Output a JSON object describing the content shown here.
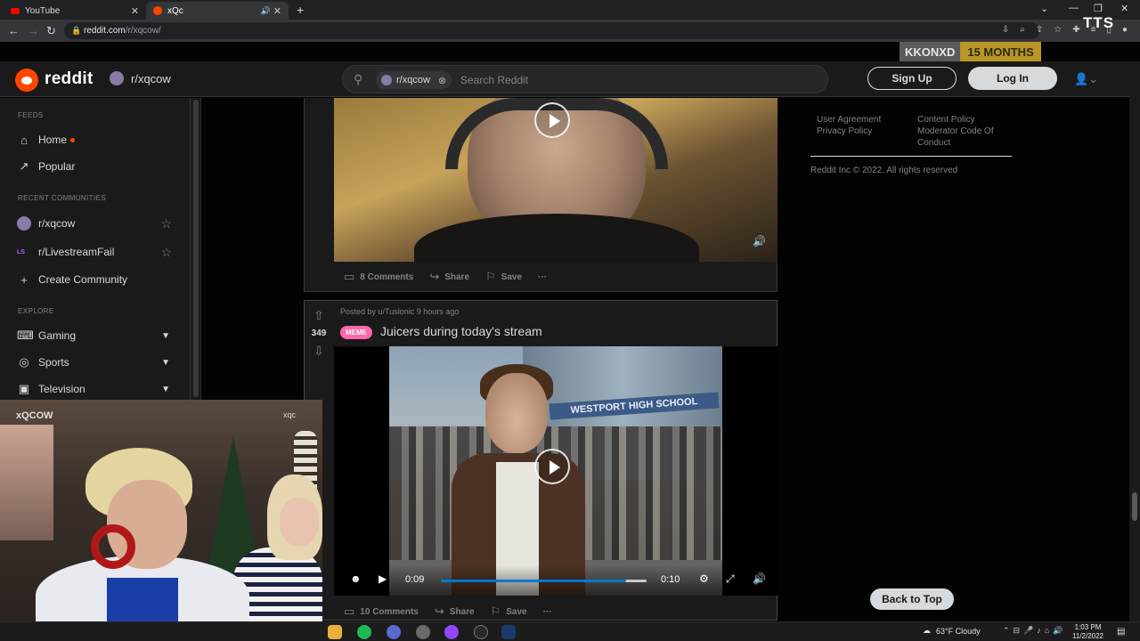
{
  "browser": {
    "tabs": [
      {
        "label": "YouTube",
        "favicon": "youtube-icon"
      },
      {
        "label": "xQc",
        "favicon": "reddit-icon",
        "active": true,
        "playing_audio": true
      }
    ],
    "url_host": "reddit.com",
    "url_path": "/r/xqcow/",
    "new_tab": "+",
    "window_controls": [
      "⌄",
      "—",
      "❐",
      "✕"
    ],
    "nav": {
      "back": "←",
      "forward": "→",
      "reload": "↻"
    }
  },
  "overlay": {
    "tts": "TTS",
    "sub_name": "KKONXD",
    "sub_months": "15 MONTHS"
  },
  "header": {
    "logo_text": "reddit",
    "current_sub": "r/xqcow",
    "search_chip": "r/xqcow",
    "search_placeholder": "Search Reddit",
    "signup": "Sign Up",
    "login": "Log In"
  },
  "sidebar": {
    "feeds_heading": "FEEDS",
    "feeds": [
      {
        "label": "Home",
        "icon": "home-icon",
        "dot": true
      },
      {
        "label": "Popular",
        "icon": "popular-icon"
      }
    ],
    "recent_heading": "RECENT COMMUNITIES",
    "recent": [
      {
        "label": "r/xqcow",
        "icon": "xqcow-avatar"
      },
      {
        "label": "r/LivestreamFail",
        "icon": "livestreamfail-avatar",
        "icon_text": "LS"
      }
    ],
    "create": "Create Community",
    "explore_heading": "EXPLORE",
    "explore": [
      {
        "label": "Gaming",
        "icon": "gaming-icon"
      },
      {
        "label": "Sports",
        "icon": "sports-icon"
      },
      {
        "label": "Television",
        "icon": "television-icon"
      }
    ]
  },
  "post1": {
    "comments": "8 Comments",
    "share": "Share",
    "save": "Save",
    "more": "···"
  },
  "post2": {
    "votes": "349",
    "posted_by": "Posted by u/Tuslonic 9 hours ago",
    "flair": "MEME",
    "title": "Juicers during today's stream",
    "video_sign": "WESTPORT HIGH SCHOOL",
    "time_current": "0:09",
    "time_total": "0:10",
    "progress_fraction": 0.9,
    "comments": "10 Comments",
    "share": "Share",
    "save": "Save",
    "more": "···"
  },
  "right": {
    "links_col1": [
      "User Agreement",
      "Privacy Policy"
    ],
    "links_col2": [
      "Content Policy",
      "Moderator Code Of Conduct"
    ],
    "copyright": "Reddit Inc © 2022. All rights reserved"
  },
  "back_to_top": "Back to Top",
  "webcam": {
    "logo": "xQCOW",
    "shirt_text": "xqc"
  },
  "taskbar": {
    "weather": "63°F  Cloudy",
    "time": "1:03 PM",
    "date": "11/2/2022"
  },
  "colors": {
    "reddit_orange": "#ff4500",
    "flair_pink": "#ff66ac",
    "progress_blue": "#0079d3",
    "sub_badge_gold": "#b99627"
  }
}
